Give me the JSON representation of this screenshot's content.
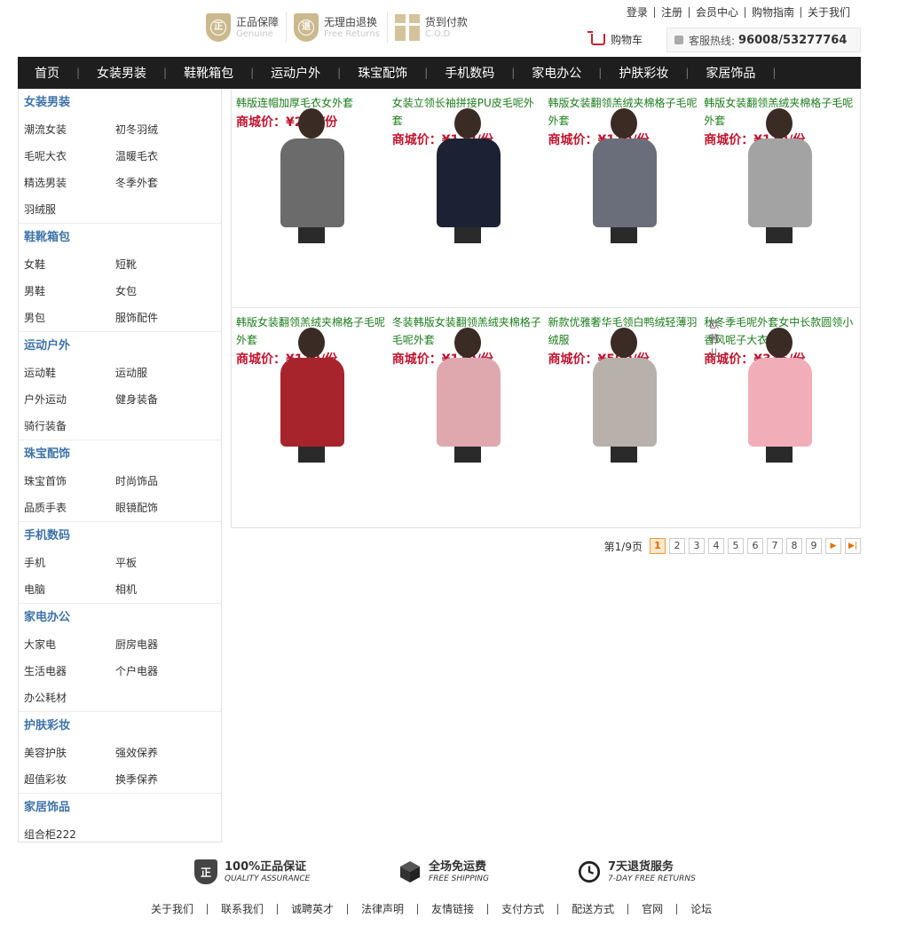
{
  "guarantees": [
    {
      "cn": "正品保障",
      "en": "Genuine",
      "icon_char": "正",
      "icon": "shield-genuine-icon"
    },
    {
      "cn": "无理由退换",
      "en": "Free Returns",
      "icon_char": "退",
      "icon": "shield-returns-icon"
    },
    {
      "cn": "货到付款",
      "en": "C.O.D",
      "icon": "gift-box-icon"
    }
  ],
  "toplinks": [
    "登录",
    "注册",
    "会员中心",
    "购物指南",
    "关于我们"
  ],
  "cart": {
    "label": "购物车",
    "icon": "cart-icon"
  },
  "hotline": {
    "label": "客服热线:",
    "number": "96008/53277764",
    "icon": "phone-icon"
  },
  "nav": [
    "首页",
    "女装男装",
    "鞋靴箱包",
    "运动户外",
    "珠宝配饰",
    "手机数码",
    "家电办公",
    "护肤彩妆",
    "家居饰品"
  ],
  "sidebar": [
    {
      "title": "女装男装",
      "items": [
        "潮流女装",
        "初冬羽绒",
        "毛呢大衣",
        "温暖毛衣",
        "精选男装",
        "冬季外套",
        "羽绒服"
      ]
    },
    {
      "title": "鞋靴箱包",
      "items": [
        "女鞋",
        "短靴",
        "男鞋",
        "女包",
        "男包",
        "服饰配件"
      ]
    },
    {
      "title": "运动户外",
      "items": [
        "运动鞋",
        "运动服",
        "户外运动",
        "健身装备",
        "骑行装备"
      ]
    },
    {
      "title": "珠宝配饰",
      "items": [
        "珠宝首饰",
        "时尚饰品",
        "品质手表",
        "眼镜配饰"
      ]
    },
    {
      "title": "手机数码",
      "items": [
        "手机",
        "平板",
        "电脑",
        "相机"
      ]
    },
    {
      "title": "家电办公",
      "items": [
        "大家电",
        "厨房电器",
        "生活电器",
        "个户电器",
        "办公耗材"
      ]
    },
    {
      "title": "护肤彩妆",
      "items": [
        "美容护肤",
        "强效保养",
        "超值彩妆",
        "换季保养"
      ]
    },
    {
      "title": "家居饰品",
      "items": [
        "组合柜222"
      ]
    }
  ],
  "price_label": "商城价：",
  "products": [
    {
      "name": "韩版连帽加厚毛衣女外套",
      "price": "¥228/份",
      "bg": "#bdbdbd",
      "coat": "#6b6b6b"
    },
    {
      "name": "女装立领长袖拼接PU皮毛呢外套",
      "price": "¥172/份",
      "bg": "#c9c0b8",
      "coat": "#1c2233"
    },
    {
      "name": "韩版女装翻领羔绒夹棉格子毛呢外套",
      "price": "¥119/份",
      "bg": "#a7b4c3",
      "coat": "#6a6e7a"
    },
    {
      "name": "韩版女装翻领羔绒夹棉格子毛呢外套",
      "price": "¥119/份",
      "bg": "#e5e5e3",
      "coat": "#a3a3a3"
    },
    {
      "name": "韩版女装翻领羔绒夹棉格子毛呢外套",
      "price": "¥119/份",
      "bg": "#d8d4d0",
      "coat": "#a8242c"
    },
    {
      "name": "冬装韩版女装翻领羔绒夹棉格子毛呢外套",
      "price": "¥119/份",
      "bg": "#ececec",
      "coat": "#dfa8ae"
    },
    {
      "name": "新款优雅奢华毛领白鸭绒轻薄羽绒服",
      "price": "¥590/份",
      "bg": "#f1f1f1",
      "coat": "#b8b1ab"
    },
    {
      "name": "秋冬季毛呢外套女中长款圆领小香风呢子大衣",
      "price": "¥336/份",
      "bg": "#f3e3e6",
      "coat": "#f2aeb8",
      "watermark": "欧茜儿"
    }
  ],
  "pager": {
    "info": "第1/9页",
    "pages": [
      "1",
      "2",
      "3",
      "4",
      "5",
      "6",
      "7",
      "8",
      "9"
    ],
    "next": "▶",
    "last": "▶|"
  },
  "footer": {
    "services": [
      {
        "t1": "100%正品保证",
        "t2": "QUALITY ASSURANCE",
        "icon": "shield-quality-icon",
        "icon_char": "正"
      },
      {
        "t1": "全场免运费",
        "t2": "FREE SHIPPING",
        "icon": "box-shipping-icon"
      },
      {
        "t1": "7天退货服务",
        "t2": "7-DAY FREE RETURNS",
        "icon": "clock-return-icon"
      }
    ],
    "links": [
      "关于我们",
      "联系我们",
      "诚聘英才",
      "法律声明",
      "友情链接",
      "支付方式",
      "配送方式",
      "官网",
      "论坛"
    ]
  }
}
